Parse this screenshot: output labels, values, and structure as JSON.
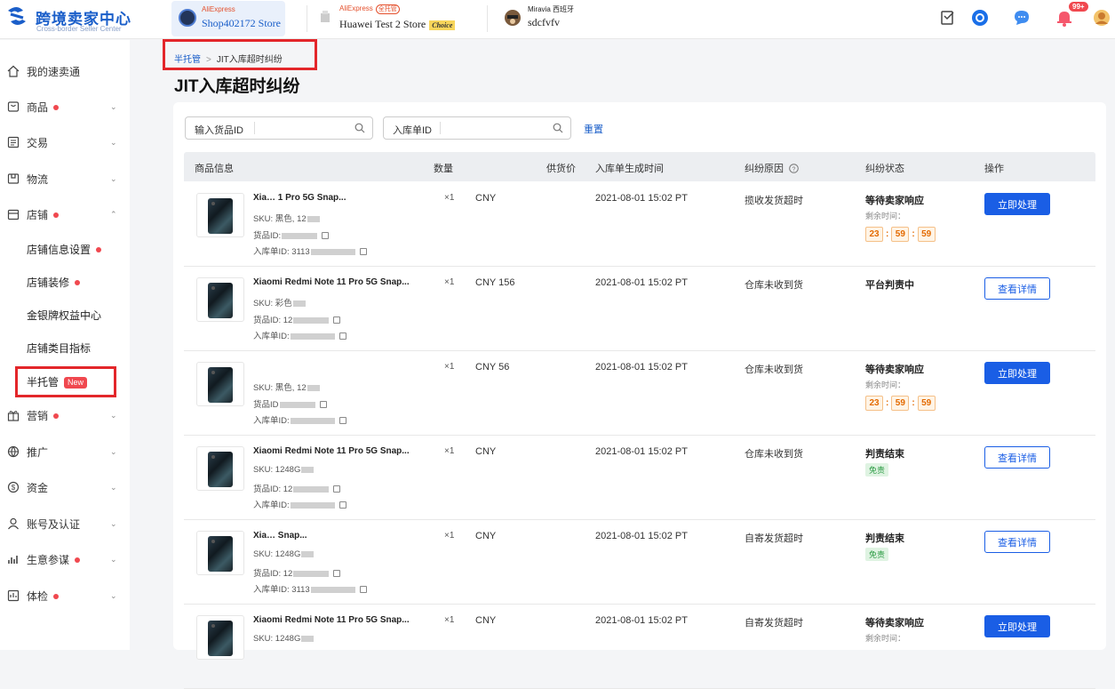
{
  "header": {
    "logo_title": "跨境卖家中心",
    "logo_subtitle": "Cross-border Seller Center",
    "stores": [
      {
        "brand": "AliExpress",
        "name": "Shop402172 Store",
        "tag": "",
        "choice": ""
      },
      {
        "brand": "AliExpress",
        "name": "Huawei Test 2 Store",
        "tag": "全托管",
        "choice": "Choice"
      },
      {
        "brand": "Miravia 西班牙",
        "name": "sdcfvfv",
        "tag": "",
        "choice": ""
      }
    ],
    "notification_count": "99+"
  },
  "sidebar": {
    "items": [
      {
        "label": "我的速卖通",
        "dot": false,
        "chevron": ""
      },
      {
        "label": "商品",
        "dot": true,
        "chevron": "⌄"
      },
      {
        "label": "交易",
        "dot": false,
        "chevron": "⌄"
      },
      {
        "label": "物流",
        "dot": false,
        "chevron": "⌄"
      },
      {
        "label": "店铺",
        "dot": true,
        "chevron": "⌃"
      },
      {
        "label": "营销",
        "dot": true,
        "chevron": "⌄"
      },
      {
        "label": "推广",
        "dot": false,
        "chevron": "⌄"
      },
      {
        "label": "资金",
        "dot": false,
        "chevron": "⌄"
      },
      {
        "label": "账号及认证",
        "dot": false,
        "chevron": "⌄"
      },
      {
        "label": "生意参谋",
        "dot": true,
        "chevron": "⌄"
      },
      {
        "label": "体检",
        "dot": true,
        "chevron": "⌄"
      }
    ],
    "store_sub_items": [
      {
        "label": "店铺信息设置",
        "dot": true
      },
      {
        "label": "店铺装修",
        "dot": true
      },
      {
        "label": "金银牌权益中心",
        "dot": false
      },
      {
        "label": "店铺类目指标",
        "dot": false
      },
      {
        "label": "半托管",
        "dot": false,
        "badge": "New"
      }
    ]
  },
  "breadcrumb": {
    "parent": "半托管",
    "separator": ">",
    "current": "JIT入库超时纠纷"
  },
  "page_title": "JIT入库超时纠纷",
  "filters": {
    "goods_id_label": "输入货品ID",
    "inbound_id_label": "入库单ID",
    "reset": "重置"
  },
  "table": {
    "headers": [
      "商品信息",
      "数量",
      "供货价",
      "入库单生成时间",
      "纠纷原因",
      "纠纷状态",
      "操作"
    ],
    "rows": [
      {
        "name": "Xia… 1 Pro 5G Snap...",
        "sku": "SKU: 黑色, 12",
        "goods_id": "货品ID:",
        "inbound_id": "入库单ID: 3113",
        "qty": "×1",
        "price": "CNY",
        "time": "2021-08-01 15:02 PT",
        "reason": "揽收发货超时",
        "status": "等待卖家响应",
        "remain_label": "剩余时间：",
        "timer": [
          "23",
          "59",
          "59"
        ],
        "badge": "",
        "action": "立即处理",
        "action_primary": true
      },
      {
        "name": "Xiaomi Redmi Note 11 Pro 5G Snap...",
        "sku": "SKU: 彩色",
        "goods_id": "货品ID: 12",
        "inbound_id": "入库单ID:",
        "qty": "×1",
        "price": "CNY 156",
        "time": "2021-08-01 15:02 PT",
        "reason": "仓库未收到货",
        "status": "平台判责中",
        "remain_label": "",
        "timer": [],
        "badge": "",
        "action": "查看详情",
        "action_primary": false
      },
      {
        "name": "",
        "sku": "SKU: 黑色, 12",
        "goods_id": "货品ID",
        "inbound_id": "入库单ID:",
        "qty": "×1",
        "price": "CNY 56",
        "time": "2021-08-01 15:02 PT",
        "reason": "仓库未收到货",
        "status": "等待卖家响应",
        "remain_label": "剩余时间：",
        "timer": [
          "23",
          "59",
          "59"
        ],
        "badge": "",
        "action": "立即处理",
        "action_primary": true
      },
      {
        "name": "Xiaomi Redmi Note 11 Pro 5G Snap...",
        "sku": "SKU: 1248G",
        "goods_id": "货品ID: 12",
        "inbound_id": "入库单ID:",
        "qty": "×1",
        "price": "CNY",
        "time": "2021-08-01 15:02 PT",
        "reason": "仓库未收到货",
        "status": "判责结束",
        "remain_label": "",
        "timer": [],
        "badge": "免责",
        "action": "查看详情",
        "action_primary": false
      },
      {
        "name": "Xia… Snap...",
        "sku": "SKU: 1248G",
        "goods_id": "货品ID: 12",
        "inbound_id": "入库单ID: 3113",
        "qty": "×1",
        "price": "CNY",
        "time": "2021-08-01 15:02 PT",
        "reason": "自寄发货超时",
        "status": "判责结束",
        "remain_label": "",
        "timer": [],
        "badge": "免责",
        "action": "查看详情",
        "action_primary": false
      },
      {
        "name": "Xiaomi Redmi Note 11 Pro 5G Snap...",
        "sku": "SKU: 1248G",
        "goods_id": "",
        "inbound_id": "",
        "qty": "×1",
        "price": "CNY",
        "time": "2021-08-01 15:02 PT",
        "reason": "自寄发货超时",
        "status": "等待卖家响应",
        "remain_label": "剩余时间：",
        "timer": [],
        "badge": "",
        "action": "立即处理",
        "action_primary": true
      }
    ]
  },
  "colors": {
    "primary": "#1a5ee5",
    "highlight_box": "#e3262a",
    "timer": "#e36a00",
    "free_badge": "#2c9b44"
  }
}
